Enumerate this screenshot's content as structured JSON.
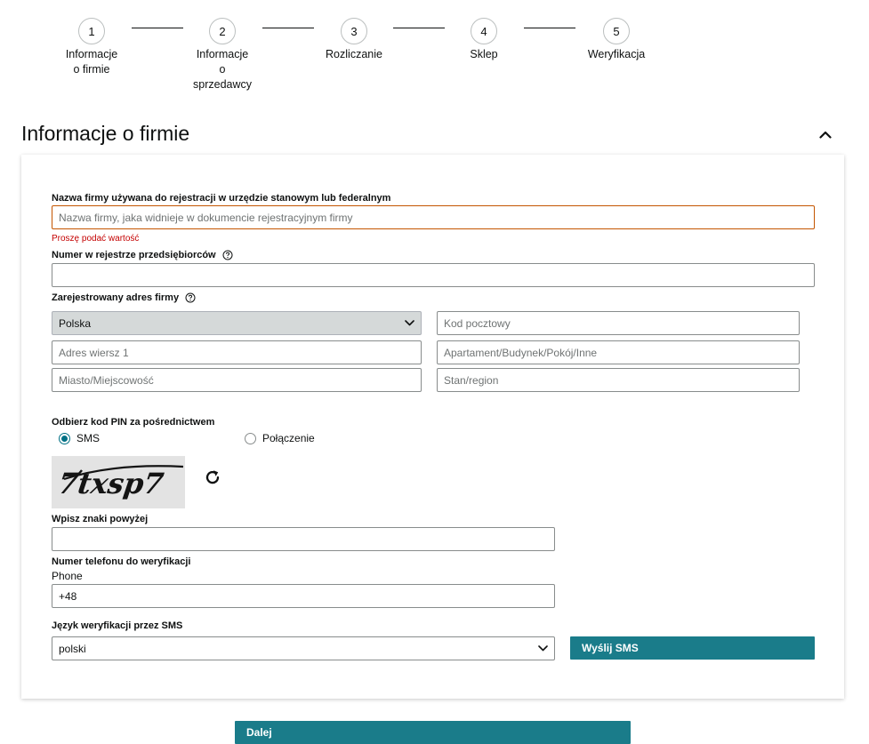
{
  "stepper": {
    "steps": [
      {
        "number": "1",
        "label_lines": [
          "Informacje",
          "o firmie"
        ]
      },
      {
        "number": "2",
        "label_lines": [
          "Informacje",
          "o",
          "sprzedawcy"
        ]
      },
      {
        "number": "3",
        "label_lines": [
          "Rozliczanie"
        ]
      },
      {
        "number": "4",
        "label_lines": [
          "Sklep"
        ]
      },
      {
        "number": "5",
        "label_lines": [
          "Weryfikacja"
        ]
      }
    ]
  },
  "section": {
    "title": "Informacje o firmie",
    "collapse_icon": "chevron-up-icon"
  },
  "form": {
    "company_name": {
      "label": "Nazwa firmy używana do rejestracji w urzędzie stanowym lub federalnym",
      "placeholder": "Nazwa firmy, jaka widnieje w dokumencie rejestracyjnym firmy",
      "error": "Proszę podać wartość"
    },
    "registry_number": {
      "label": "Numer w rejestrze przedsiębiorców",
      "value": ""
    },
    "address": {
      "label": "Zarejestrowany adres firmy",
      "country": "Polska",
      "postal_code_placeholder": "Kod pocztowy",
      "address_line1_placeholder": "Adres wiersz 1",
      "address_line2_placeholder": "Apartament/Budynek/Pokój/Inne",
      "city_placeholder": "Miasto/Miejscowość",
      "state_placeholder": "Stan/region"
    },
    "pin": {
      "label": "Odbierz kod PIN za pośrednictwem",
      "options": [
        {
          "label": "SMS",
          "checked": true
        },
        {
          "label": "Połączenie",
          "checked": false
        }
      ]
    },
    "captcha": {
      "text": "7txsp7",
      "input_label": "Wpisz znaki powyżej",
      "value": ""
    },
    "phone": {
      "label": "Numer telefonu do weryfikacji",
      "sub_label": "Phone",
      "value": "+48"
    },
    "sms_language": {
      "label": "Język weryfikacji przez SMS",
      "value": "polski"
    },
    "send_sms_label": "Wyślij SMS"
  },
  "next_label": "Dalej",
  "colors": {
    "accent": "#1a7c8a",
    "error": "#c40000",
    "error_border": "#c45500"
  }
}
